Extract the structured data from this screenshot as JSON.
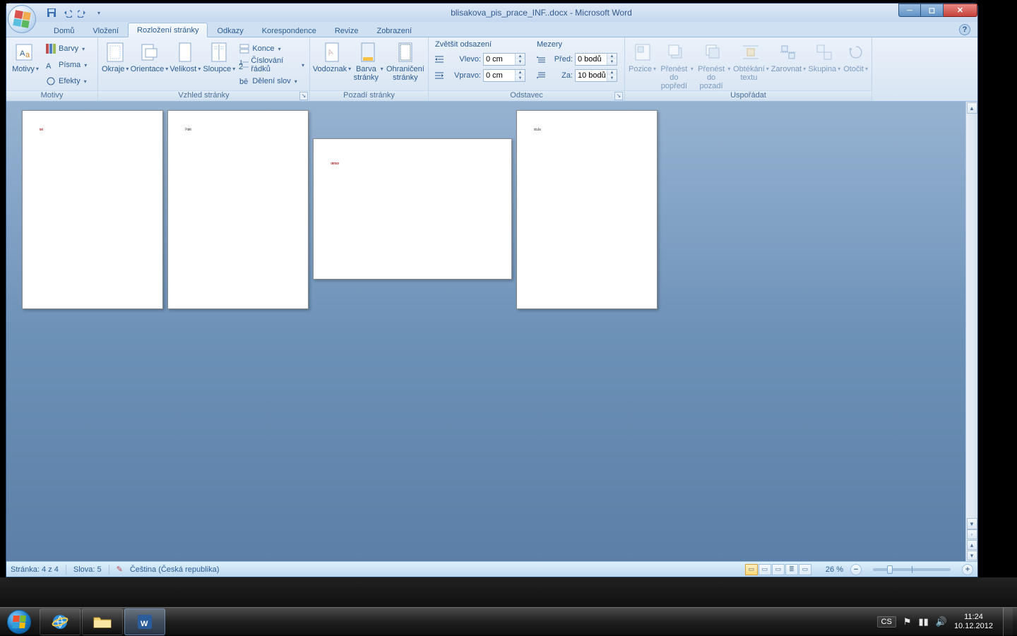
{
  "window": {
    "title": "blisakova_pis_prace_INF..docx - Microsoft Word"
  },
  "tabs": [
    "Domů",
    "Vložení",
    "Rozložení stránky",
    "Odkazy",
    "Korespondence",
    "Revize",
    "Zobrazení"
  ],
  "active_tab": 2,
  "groups": {
    "motivy": {
      "label": "Motivy",
      "motivy": "Motivy",
      "barvy": "Barvy",
      "pisma": "Písma",
      "efekty": "Efekty"
    },
    "vzhled": {
      "label": "Vzhled stránky",
      "okraje": "Okraje",
      "orientace": "Orientace",
      "velikost": "Velikost",
      "sloupce": "Sloupce",
      "konce": "Konce",
      "cislovani": "Číslování řádků",
      "deleni": "Dělení slov"
    },
    "pozadi": {
      "label": "Pozadí stránky",
      "vodoznak": "Vodoznak",
      "barva": "Barva stránky",
      "ohraniceni": "Ohraničení stránky"
    },
    "odstavec": {
      "label": "Odstavec",
      "zvetsit": "Zvětšit odsazení",
      "vlevo": "Vlevo:",
      "vpravo": "Vpravo:",
      "mezery_head": "Mezery",
      "pred": "Před:",
      "za": "Za:",
      "vlevo_val": "0 cm",
      "vpravo_val": "0 cm",
      "pred_val": "0 bodů",
      "za_val": "10 bodů"
    },
    "usporadat": {
      "label": "Uspořádat",
      "pozice": "Pozice",
      "popredi": "Přenést do popředí",
      "pozadi": "Přenést do pozadí",
      "obtekani": "Obtékání textu",
      "zarovnat": "Zarovnat",
      "skupina": "Skupina",
      "otocit": "Otočit"
    }
  },
  "pages": {
    "p1": "text",
    "p2": "Portrét",
    "p3": "orientace",
    "p4": "tabulka"
  },
  "status": {
    "page": "Stránka: 4 z 4",
    "words": "Slova: 5",
    "lang": "Čeština (Česká republika)",
    "zoom": "26 %"
  },
  "taskbar": {
    "lang": "CS",
    "time": "11:24",
    "date": "10.12.2012"
  }
}
